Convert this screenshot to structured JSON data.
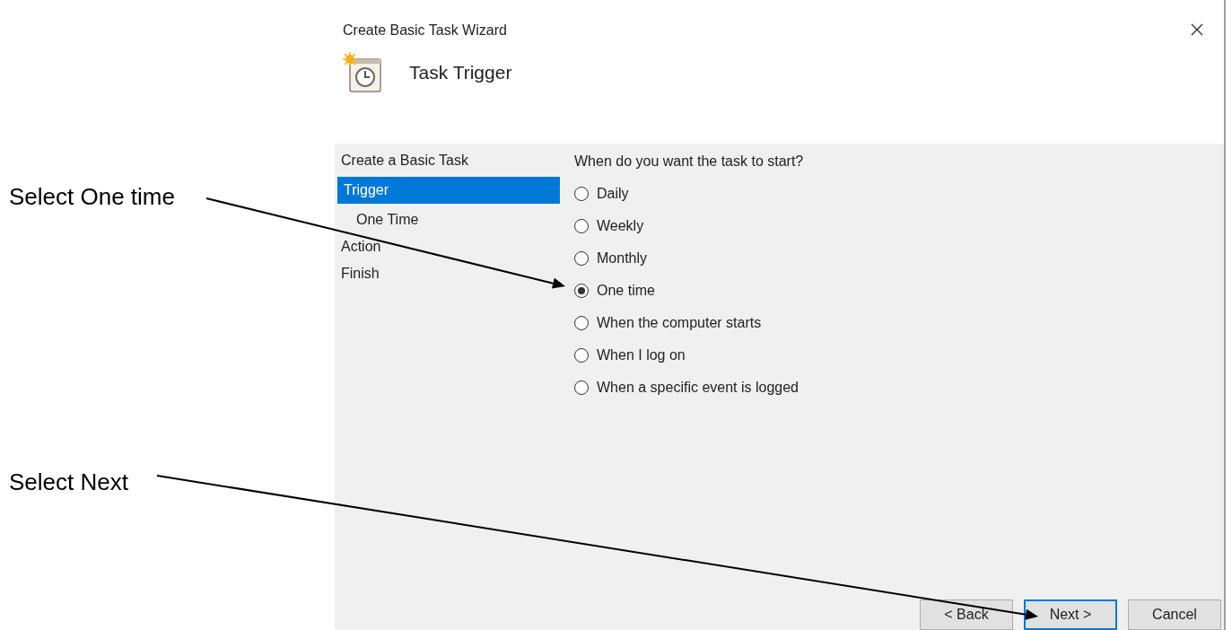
{
  "window": {
    "title": "Create Basic Task Wizard"
  },
  "header": {
    "title": "Task Trigger"
  },
  "steps": [
    {
      "label": "Create a Basic Task",
      "selected": false
    },
    {
      "label": "Trigger",
      "selected": true,
      "children": [
        {
          "label": "One Time",
          "selected": false
        }
      ]
    },
    {
      "label": "Action",
      "selected": false
    },
    {
      "label": "Finish",
      "selected": false
    }
  ],
  "prompt": "When do you want the task to start?",
  "options": [
    {
      "label": "Daily",
      "selected": false
    },
    {
      "label": "Weekly",
      "selected": false
    },
    {
      "label": "Monthly",
      "selected": false
    },
    {
      "label": "One time",
      "selected": true
    },
    {
      "label": "When the computer starts",
      "selected": false
    },
    {
      "label": "When I log on",
      "selected": false
    },
    {
      "label": "When a specific event is logged",
      "selected": false
    }
  ],
  "buttons": [
    {
      "label": "< Back",
      "focused": false
    },
    {
      "label": "Next >",
      "focused": true
    },
    {
      "label": "Cancel",
      "focused": false
    }
  ],
  "annotations": [
    {
      "text": "Select One time"
    },
    {
      "text": "Select Next"
    }
  ]
}
